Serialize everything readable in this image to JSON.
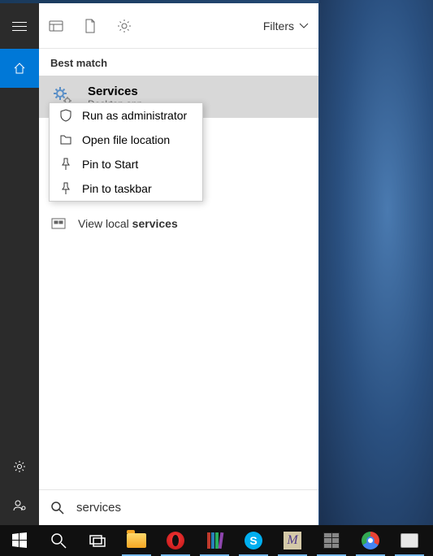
{
  "topbar": {
    "filters_label": "Filters"
  },
  "section": {
    "best_match": "Best match"
  },
  "result": {
    "title": "Services",
    "subtitle": "Desktop app"
  },
  "context_menu": {
    "run_admin": "Run as administrator",
    "open_location": "Open file location",
    "pin_start": "Pin to Start",
    "pin_taskbar": "Pin to taskbar"
  },
  "partial": {
    "prefix": "View local ",
    "bold": "services"
  },
  "search": {
    "value": "services"
  }
}
